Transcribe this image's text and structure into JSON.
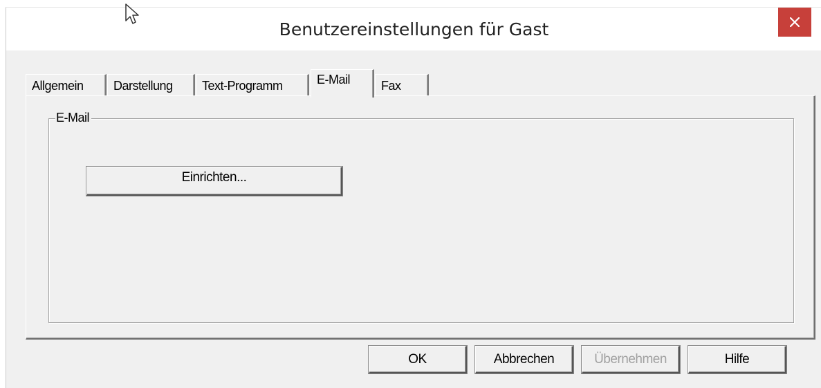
{
  "window": {
    "title": "Benutzereinstellungen für Gast",
    "close_icon": "close-icon",
    "close_color": "#c7403a"
  },
  "tabs": [
    {
      "label": "Allgemein",
      "active": false
    },
    {
      "label": "Darstellung",
      "active": false
    },
    {
      "label": "Text-Programm",
      "active": false
    },
    {
      "label": "E-Mail",
      "active": true
    },
    {
      "label": "Fax",
      "active": false
    }
  ],
  "email_group": {
    "legend": "E-Mail",
    "setup_button": "Einrichten..."
  },
  "footer": {
    "ok": "OK",
    "cancel": "Abbrechen",
    "apply": "Übernehmen",
    "apply_disabled": true,
    "help": "Hilfe"
  }
}
